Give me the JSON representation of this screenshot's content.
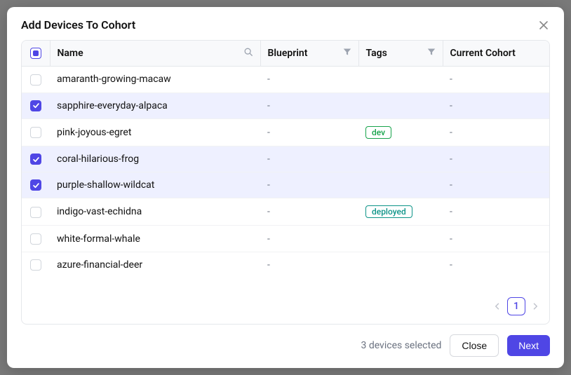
{
  "modal": {
    "title": "Add Devices To Cohort"
  },
  "columns": {
    "name": "Name",
    "blueprint": "Blueprint",
    "tags": "Tags",
    "cohort": "Current Cohort"
  },
  "rows": [
    {
      "name": "amaranth-growing-macaw",
      "blueprint": "-",
      "tags": [],
      "cohort": "-",
      "selected": false
    },
    {
      "name": "sapphire-everyday-alpaca",
      "blueprint": "-",
      "tags": [],
      "cohort": "-",
      "selected": true
    },
    {
      "name": "pink-joyous-egret",
      "blueprint": "-",
      "tags": [
        {
          "label": "dev",
          "color": "green"
        }
      ],
      "cohort": "-",
      "selected": false
    },
    {
      "name": "coral-hilarious-frog",
      "blueprint": "-",
      "tags": [],
      "cohort": "-",
      "selected": true
    },
    {
      "name": "purple-shallow-wildcat",
      "blueprint": "-",
      "tags": [],
      "cohort": "-",
      "selected": true
    },
    {
      "name": "indigo-vast-echidna",
      "blueprint": "-",
      "tags": [
        {
          "label": "deployed",
          "color": "teal"
        }
      ],
      "cohort": "-",
      "selected": false
    },
    {
      "name": "white-formal-whale",
      "blueprint": "-",
      "tags": [],
      "cohort": "-",
      "selected": false
    },
    {
      "name": "azure-financial-deer",
      "blueprint": "-",
      "tags": [],
      "cohort": "-",
      "selected": false
    }
  ],
  "pagination": {
    "current": "1"
  },
  "footer": {
    "selected_text": "3 devices selected",
    "close_label": "Close",
    "next_label": "Next"
  }
}
